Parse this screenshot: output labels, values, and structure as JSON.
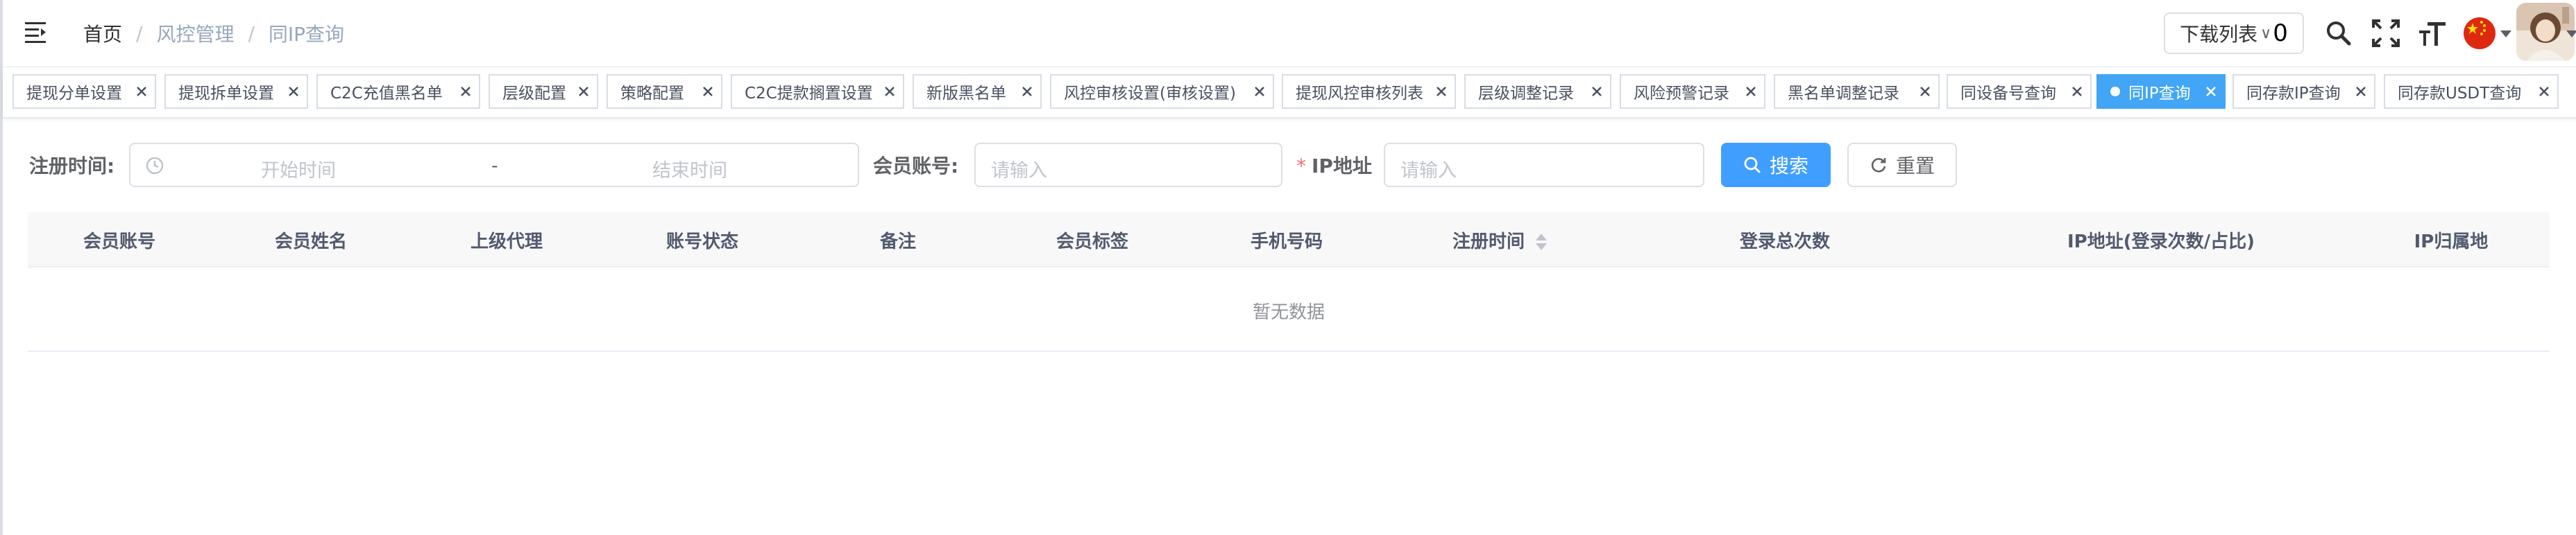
{
  "breadcrumb": [
    "首页",
    "风控管理",
    "同IP查询"
  ],
  "header": {
    "download_label": "下载列表",
    "download_count": "0",
    "icons": [
      "search-icon",
      "fullscreen-icon",
      "font-size-icon",
      "language-flag-icon"
    ]
  },
  "tags": [
    {
      "label": "提现分单设置",
      "active": false
    },
    {
      "label": "提现拆单设置",
      "active": false
    },
    {
      "label": "C2C充值黑名单",
      "active": false
    },
    {
      "label": "层级配置",
      "active": false
    },
    {
      "label": "策略配置",
      "active": false
    },
    {
      "label": "C2C提款搁置设置",
      "active": false
    },
    {
      "label": "新版黑名单",
      "active": false
    },
    {
      "label": "风控审核设置(审核设置)",
      "active": false
    },
    {
      "label": "提现风控审核列表",
      "active": false
    },
    {
      "label": "层级调整记录",
      "active": false
    },
    {
      "label": "风险预警记录",
      "active": false
    },
    {
      "label": "黑名单调整记录",
      "active": false
    },
    {
      "label": "同设备号查询",
      "active": false
    },
    {
      "label": "同IP查询",
      "active": true
    },
    {
      "label": "同存款IP查询",
      "active": false
    },
    {
      "label": "同存款USDT查询",
      "active": false
    }
  ],
  "filters": {
    "register_time_label": "注册时间:",
    "start_placeholder": "开始时间",
    "range_separator": "-",
    "end_placeholder": "结束时间",
    "account_label": "会员账号:",
    "account_placeholder": "请输入",
    "ip_required_mark": "*",
    "ip_label": "IP地址",
    "ip_placeholder": "请输入",
    "search_label": "搜索",
    "reset_label": "重置"
  },
  "table": {
    "columns": [
      "会员账号",
      "会员姓名",
      "上级代理",
      "账号状态",
      "备注",
      "会员标签",
      "手机号码",
      "注册时间",
      "登录总次数",
      "IP地址(登录次数/占比)",
      "IP归属地"
    ],
    "sortable_column": "注册时间",
    "empty_text": "暂无数据"
  },
  "colors": {
    "primary": "#409eff",
    "active_tag": "#42a5f5",
    "required": "#f56c6c"
  }
}
